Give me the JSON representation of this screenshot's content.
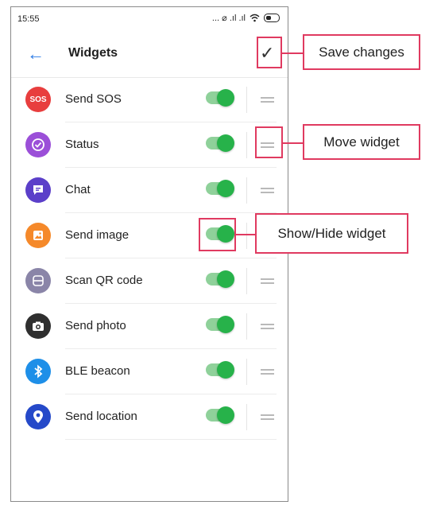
{
  "status_bar": {
    "time": "15:55",
    "signal_text": "... ⌀ .ıl .ıl"
  },
  "header": {
    "title": "Widgets",
    "back_icon": "arrow-left-icon",
    "save_icon": "check-icon"
  },
  "widgets": [
    {
      "label": "Send SOS",
      "icon": "sos-icon",
      "icon_text": "SOS",
      "color": "#e83e3e",
      "enabled": true
    },
    {
      "label": "Status",
      "icon": "status-check-icon",
      "color": "#9b4fd8",
      "enabled": true
    },
    {
      "label": "Chat",
      "icon": "chat-icon",
      "color": "#5b3fc9",
      "enabled": true
    },
    {
      "label": "Send image",
      "icon": "image-icon",
      "color": "#f5892a",
      "enabled": true
    },
    {
      "label": "Scan QR code",
      "icon": "scan-icon",
      "color": "#8a85a8",
      "enabled": true
    },
    {
      "label": "Send photo",
      "icon": "camera-icon",
      "color": "#2f2f2f",
      "enabled": true
    },
    {
      "label": "BLE beacon",
      "icon": "bluetooth-icon",
      "color": "#1e8fe8",
      "enabled": true
    },
    {
      "label": "Send location",
      "icon": "location-pin-icon",
      "color": "#2549c9",
      "enabled": true
    }
  ],
  "callouts": {
    "save": "Save changes",
    "move": "Move widget",
    "toggle": "Show/Hide widget"
  },
  "colors": {
    "accent": "#2c7be5",
    "toggle_on": "#27b24a",
    "highlight": "#e03a60"
  }
}
